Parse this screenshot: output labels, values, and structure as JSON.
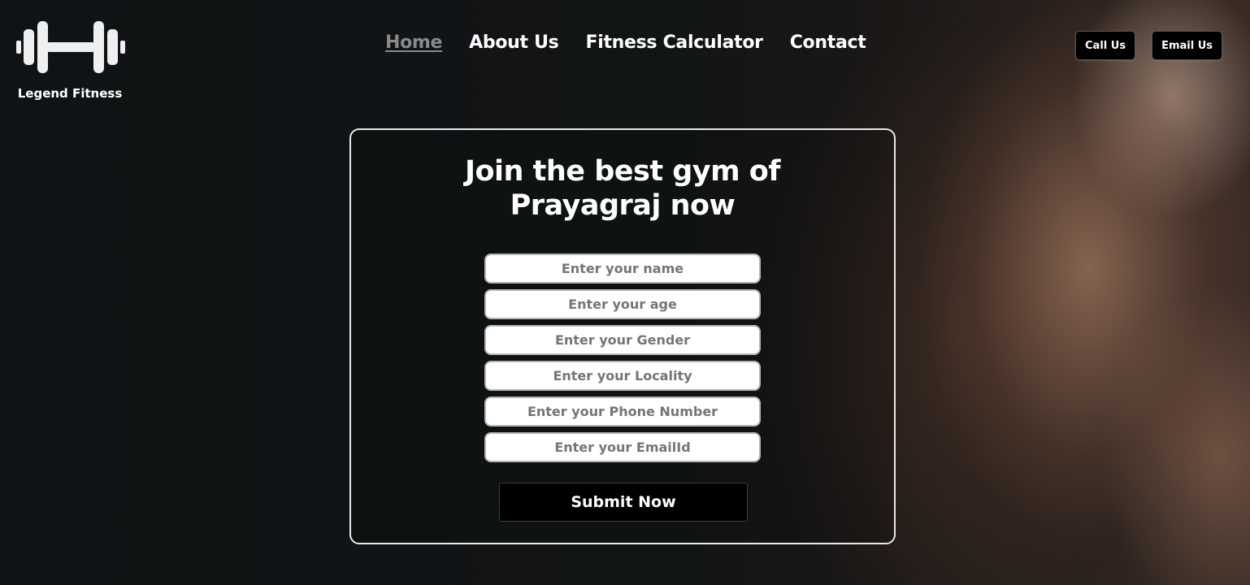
{
  "brand": {
    "name": "Legend Fitness",
    "logo_icon": "dumbbell-icon"
  },
  "nav": {
    "items": [
      {
        "label": "Home",
        "active": true
      },
      {
        "label": "About Us",
        "active": false
      },
      {
        "label": "Fitness Calculator",
        "active": false
      },
      {
        "label": "Contact",
        "active": false
      }
    ]
  },
  "header_actions": {
    "call_label": "Call Us",
    "email_label": "Email Us"
  },
  "form": {
    "title_line1": "Join the best gym of",
    "title_line2": "Prayagraj now",
    "fields": [
      {
        "placeholder": "Enter your name",
        "value": ""
      },
      {
        "placeholder": "Enter your age",
        "value": ""
      },
      {
        "placeholder": "Enter your Gender",
        "value": ""
      },
      {
        "placeholder": "Enter your Locality",
        "value": ""
      },
      {
        "placeholder": "Enter your Phone Number",
        "value": ""
      },
      {
        "placeholder": "Enter your EmailId",
        "value": ""
      }
    ],
    "submit_label": "Submit Now"
  },
  "colors": {
    "background": "#101214",
    "text": "#ffffff",
    "nav_active": "#8a8a8a",
    "button_bg": "#000000",
    "card_border": "#e8e8e8"
  }
}
